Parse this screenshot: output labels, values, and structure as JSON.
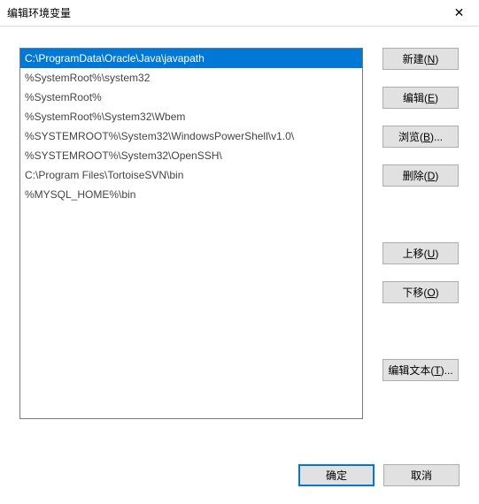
{
  "window": {
    "title": "编辑环境变量"
  },
  "paths": [
    "C:\\ProgramData\\Oracle\\Java\\javapath",
    "%SystemRoot%\\system32",
    "%SystemRoot%",
    "%SystemRoot%\\System32\\Wbem",
    "%SYSTEMROOT%\\System32\\WindowsPowerShell\\v1.0\\",
    "%SYSTEMROOT%\\System32\\OpenSSH\\",
    "C:\\Program Files\\TortoiseSVN\\bin",
    "%MYSQL_HOME%\\bin"
  ],
  "selected_index": 0,
  "buttons": {
    "new": {
      "pre": "新建(",
      "hot": "N",
      "post": ")"
    },
    "edit": {
      "pre": "编辑(",
      "hot": "E",
      "post": ")"
    },
    "browse": {
      "pre": "浏览(",
      "hot": "B",
      "post": ")..."
    },
    "delete": {
      "pre": "删除(",
      "hot": "D",
      "post": ")"
    },
    "up": {
      "pre": "上移(",
      "hot": "U",
      "post": ")"
    },
    "down": {
      "pre": "下移(",
      "hot": "O",
      "post": ")"
    },
    "text": {
      "pre": "编辑文本(",
      "hot": "T",
      "post": ")..."
    },
    "ok": "确定",
    "cancel": "取消"
  }
}
